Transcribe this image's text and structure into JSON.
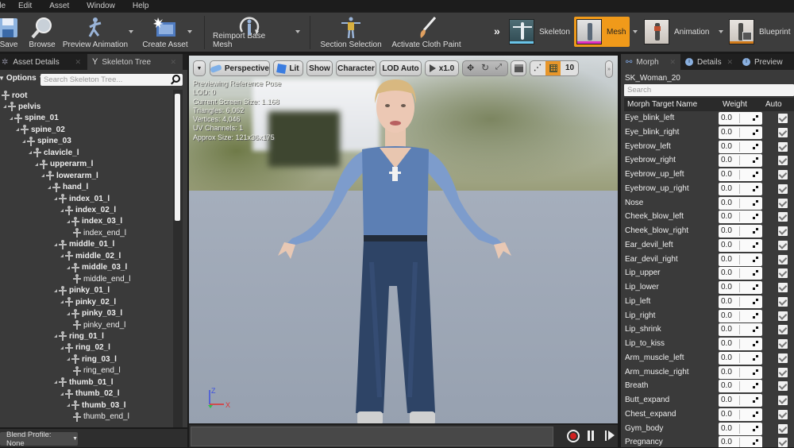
{
  "menu": [
    "ile",
    "Edit",
    "Asset",
    "Window",
    "Help"
  ],
  "toolbar": {
    "save": "Save",
    "browse": "Browse",
    "preview_animation": "Preview Animation",
    "create_asset": "Create Asset",
    "reimport_base_mesh": "Reimport Base Mesh",
    "section_selection": "Section Selection",
    "activate_cloth_paint": "Activate Cloth Paint"
  },
  "modes": {
    "skeleton": "Skeleton",
    "mesh": "Mesh",
    "animation": "Animation",
    "blueprint": "Blueprint",
    "active": "Mesh",
    "active_color": "#f09a1a"
  },
  "left_panel": {
    "tabs": [
      "Asset Details",
      "Skeleton Tree"
    ],
    "options_label": "Options",
    "search_placeholder": "Search Skeleton Tree...",
    "tree": [
      {
        "name": "root",
        "depth": 0,
        "expandable": false,
        "bold": true
      },
      {
        "name": "pelvis",
        "depth": 1,
        "expandable": true,
        "bold": true
      },
      {
        "name": "spine_01",
        "depth": 2,
        "expandable": true,
        "bold": true
      },
      {
        "name": "spine_02",
        "depth": 3,
        "expandable": true,
        "bold": true
      },
      {
        "name": "spine_03",
        "depth": 4,
        "expandable": true,
        "bold": true
      },
      {
        "name": "clavicle_l",
        "depth": 5,
        "expandable": true,
        "bold": true
      },
      {
        "name": "upperarm_l",
        "depth": 6,
        "expandable": true,
        "bold": true
      },
      {
        "name": "lowerarm_l",
        "depth": 7,
        "expandable": true,
        "bold": true
      },
      {
        "name": "hand_l",
        "depth": 8,
        "expandable": true,
        "bold": true
      },
      {
        "name": "index_01_l",
        "depth": 9,
        "expandable": true,
        "bold": true
      },
      {
        "name": "index_02_l",
        "depth": 10,
        "expandable": true,
        "bold": true
      },
      {
        "name": "index_03_l",
        "depth": 11,
        "expandable": true,
        "bold": true
      },
      {
        "name": "index_end_l",
        "depth": 12,
        "expandable": false,
        "bold": false
      },
      {
        "name": "middle_01_l",
        "depth": 9,
        "expandable": true,
        "bold": true
      },
      {
        "name": "middle_02_l",
        "depth": 10,
        "expandable": true,
        "bold": true
      },
      {
        "name": "middle_03_l",
        "depth": 11,
        "expandable": true,
        "bold": true
      },
      {
        "name": "middle_end_l",
        "depth": 12,
        "expandable": false,
        "bold": false
      },
      {
        "name": "pinky_01_l",
        "depth": 9,
        "expandable": true,
        "bold": true
      },
      {
        "name": "pinky_02_l",
        "depth": 10,
        "expandable": true,
        "bold": true
      },
      {
        "name": "pinky_03_l",
        "depth": 11,
        "expandable": true,
        "bold": true
      },
      {
        "name": "pinky_end_l",
        "depth": 12,
        "expandable": false,
        "bold": false
      },
      {
        "name": "ring_01_l",
        "depth": 9,
        "expandable": true,
        "bold": true
      },
      {
        "name": "ring_02_l",
        "depth": 10,
        "expandable": true,
        "bold": true
      },
      {
        "name": "ring_03_l",
        "depth": 11,
        "expandable": true,
        "bold": true
      },
      {
        "name": "ring_end_l",
        "depth": 12,
        "expandable": false,
        "bold": false
      },
      {
        "name": "thumb_01_l",
        "depth": 9,
        "expandable": true,
        "bold": true
      },
      {
        "name": "thumb_02_l",
        "depth": 10,
        "expandable": true,
        "bold": true
      },
      {
        "name": "thumb_03_l",
        "depth": 11,
        "expandable": true,
        "bold": true
      },
      {
        "name": "thumb_end_l",
        "depth": 12,
        "expandable": false,
        "bold": false
      }
    ],
    "blend_profile": "Blend Profile: None"
  },
  "viewport": {
    "toolbar": {
      "perspective": "Perspective",
      "lit": "Lit",
      "show": "Show",
      "character": "Character",
      "lod": "LOD Auto",
      "speed": "x1.0",
      "grid_size": "10"
    },
    "stats": [
      "Previewing Reference Pose",
      "LOD: 0",
      "Current Screen Size: 1.168",
      "Triangles: 6,062",
      "Vertices: 4,046",
      "UV Channels: 1",
      "Approx Size: 121x36x175"
    ],
    "axis": {
      "z": "Z",
      "x": "X"
    }
  },
  "right_panel": {
    "tabs": [
      "Morph",
      "Details",
      "Preview"
    ],
    "mesh_name": "SK_Woman_20",
    "search_placeholder": "Search",
    "columns": [
      "Morph Target Name",
      "Weight",
      "Auto"
    ],
    "morph_targets": [
      {
        "name": "Eye_blink_left",
        "weight": "0.0",
        "auto": true
      },
      {
        "name": "Eye_blink_right",
        "weight": "0.0",
        "auto": true
      },
      {
        "name": "Eyebrow_left",
        "weight": "0.0",
        "auto": true
      },
      {
        "name": "Eyebrow_right",
        "weight": "0.0",
        "auto": true
      },
      {
        "name": "Eyebrow_up_left",
        "weight": "0.0",
        "auto": true
      },
      {
        "name": "Eyebrow_up_right",
        "weight": "0.0",
        "auto": true
      },
      {
        "name": "Nose",
        "weight": "0.0",
        "auto": true
      },
      {
        "name": "Cheek_blow_left",
        "weight": "0.0",
        "auto": true
      },
      {
        "name": "Cheek_blow_right",
        "weight": "0.0",
        "auto": true
      },
      {
        "name": "Ear_devil_left",
        "weight": "0.0",
        "auto": true
      },
      {
        "name": "Ear_devil_right",
        "weight": "0.0",
        "auto": true
      },
      {
        "name": "Lip_upper",
        "weight": "0.0",
        "auto": true
      },
      {
        "name": "Lip_lower",
        "weight": "0.0",
        "auto": true
      },
      {
        "name": "Lip_left",
        "weight": "0.0",
        "auto": true
      },
      {
        "name": "Lip_right",
        "weight": "0.0",
        "auto": true
      },
      {
        "name": "Lip_shrink",
        "weight": "0.0",
        "auto": true
      },
      {
        "name": "Lip_to_kiss",
        "weight": "0.0",
        "auto": true
      },
      {
        "name": "Arm_muscle_left",
        "weight": "0.0",
        "auto": true
      },
      {
        "name": "Arm_muscle_right",
        "weight": "0.0",
        "auto": true
      },
      {
        "name": "Breath",
        "weight": "0.0",
        "auto": true
      },
      {
        "name": "Butt_expand",
        "weight": "0.0",
        "auto": true
      },
      {
        "name": "Chest_expand",
        "weight": "0.0",
        "auto": true
      },
      {
        "name": "Gym_body",
        "weight": "0.0",
        "auto": true
      },
      {
        "name": "Pregnancy",
        "weight": "0.0",
        "auto": true
      }
    ]
  }
}
